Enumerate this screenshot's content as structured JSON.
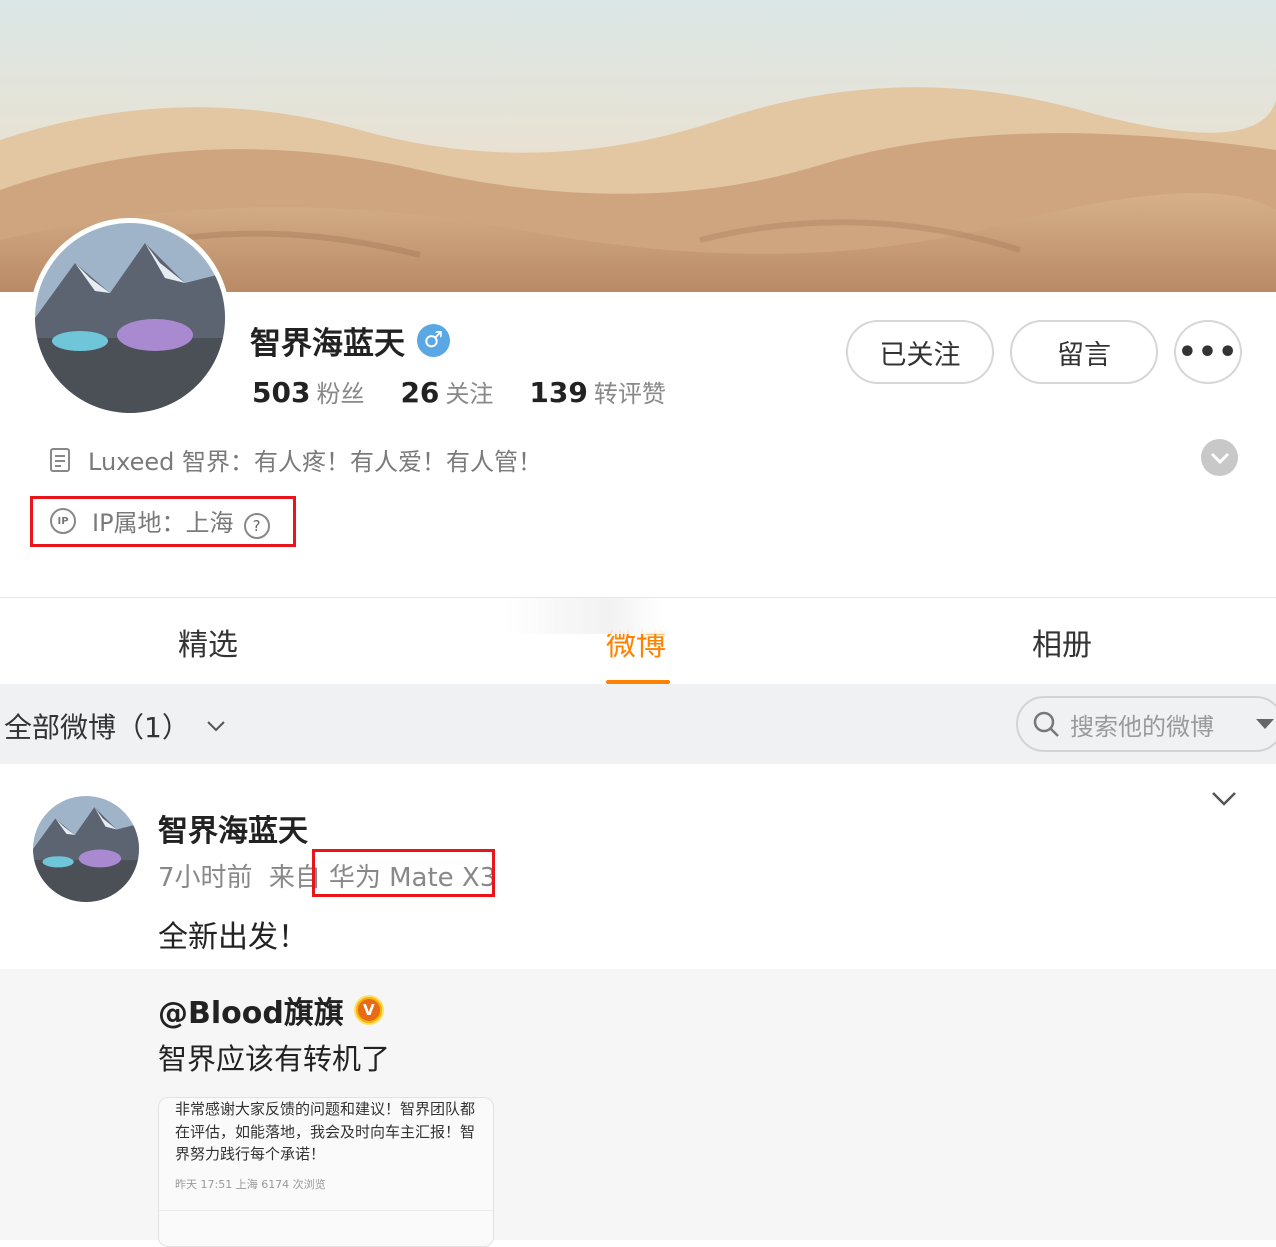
{
  "profile": {
    "name": "智界海蓝天",
    "gender_symbol": "♂",
    "stats": [
      {
        "num": "503",
        "label": "粉丝"
      },
      {
        "num": "26",
        "label": "关注"
      },
      {
        "num": "139",
        "label": "转评赞"
      }
    ],
    "bio": "Luxeed 智界：有人疼！有人爱！有人管！",
    "ip": "IP属地：上海",
    "ip_icon_text": "IP",
    "ip_help": "?"
  },
  "actions": {
    "followed": "已关注",
    "message": "留言",
    "more": "•••"
  },
  "tabs": [
    {
      "label": "精选"
    },
    {
      "label": "微博"
    },
    {
      "label": "相册"
    }
  ],
  "filter": {
    "label": "全部微博（1）",
    "search_placeholder": "搜索他的微博"
  },
  "post": {
    "author": "智界海蓝天",
    "time": "7小时前",
    "source_prefix": "来自",
    "device": "华为 Mate X3",
    "text": "全新出发！",
    "repost": {
      "user": "@Blood旗旗",
      "badge": "V",
      "text": "智界应该有转机了",
      "image_text": "非常感谢大家反馈的问题和建议！智界团队都在评估，如能落地，我会及时向车主汇报！智界努力践行每个承诺！",
      "image_meta": "昨天 17:51  上海  6174 次浏览"
    }
  },
  "colors": {
    "accent": "#ff8200",
    "highlight_box": "#e8161a",
    "verified_blue": "#5aa7e6"
  }
}
